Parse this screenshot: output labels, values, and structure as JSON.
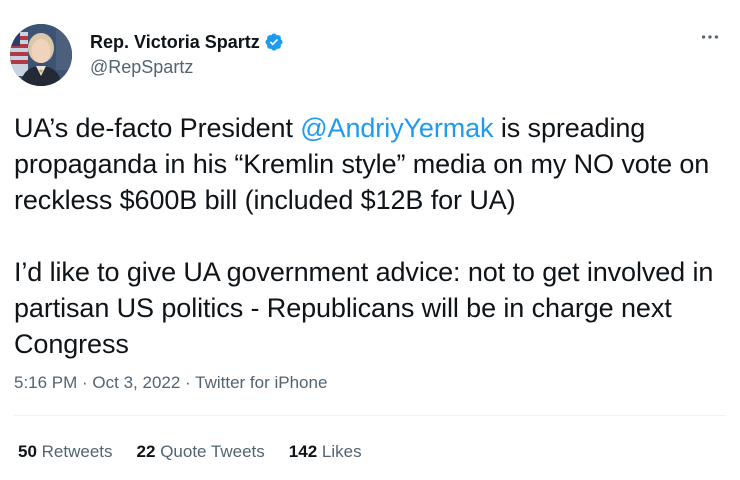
{
  "author": {
    "display_name": "Rep. Victoria Spartz",
    "handle": "@RepSpartz",
    "verified": true,
    "verified_color": "#1d9bf0",
    "avatar_icon": "profile-photo"
  },
  "more_icon": "ellipsis-icon",
  "tweet": {
    "p1_before": "UA’s de-facto President ",
    "p1_mention": "@AndriyYermak",
    "p1_after": " is spreading propaganda in his “Kremlin style” media on my NO vote on reckless $600B bill (included $12B for UA)",
    "p2": "I’d like to give UA government advice: not to get involved in partisan US politics - Republicans will be in charge next Congress",
    "mention_color": "#1d9bf0"
  },
  "meta": {
    "time": "5:16 PM",
    "sep1": " · ",
    "date": "Oct 3, 2022",
    "sep2": " · ",
    "source": "Twitter for iPhone"
  },
  "stats": [
    {
      "count": "50",
      "label": "Retweets"
    },
    {
      "count": "22",
      "label": "Quote Tweets"
    },
    {
      "count": "142",
      "label": "Likes"
    }
  ]
}
